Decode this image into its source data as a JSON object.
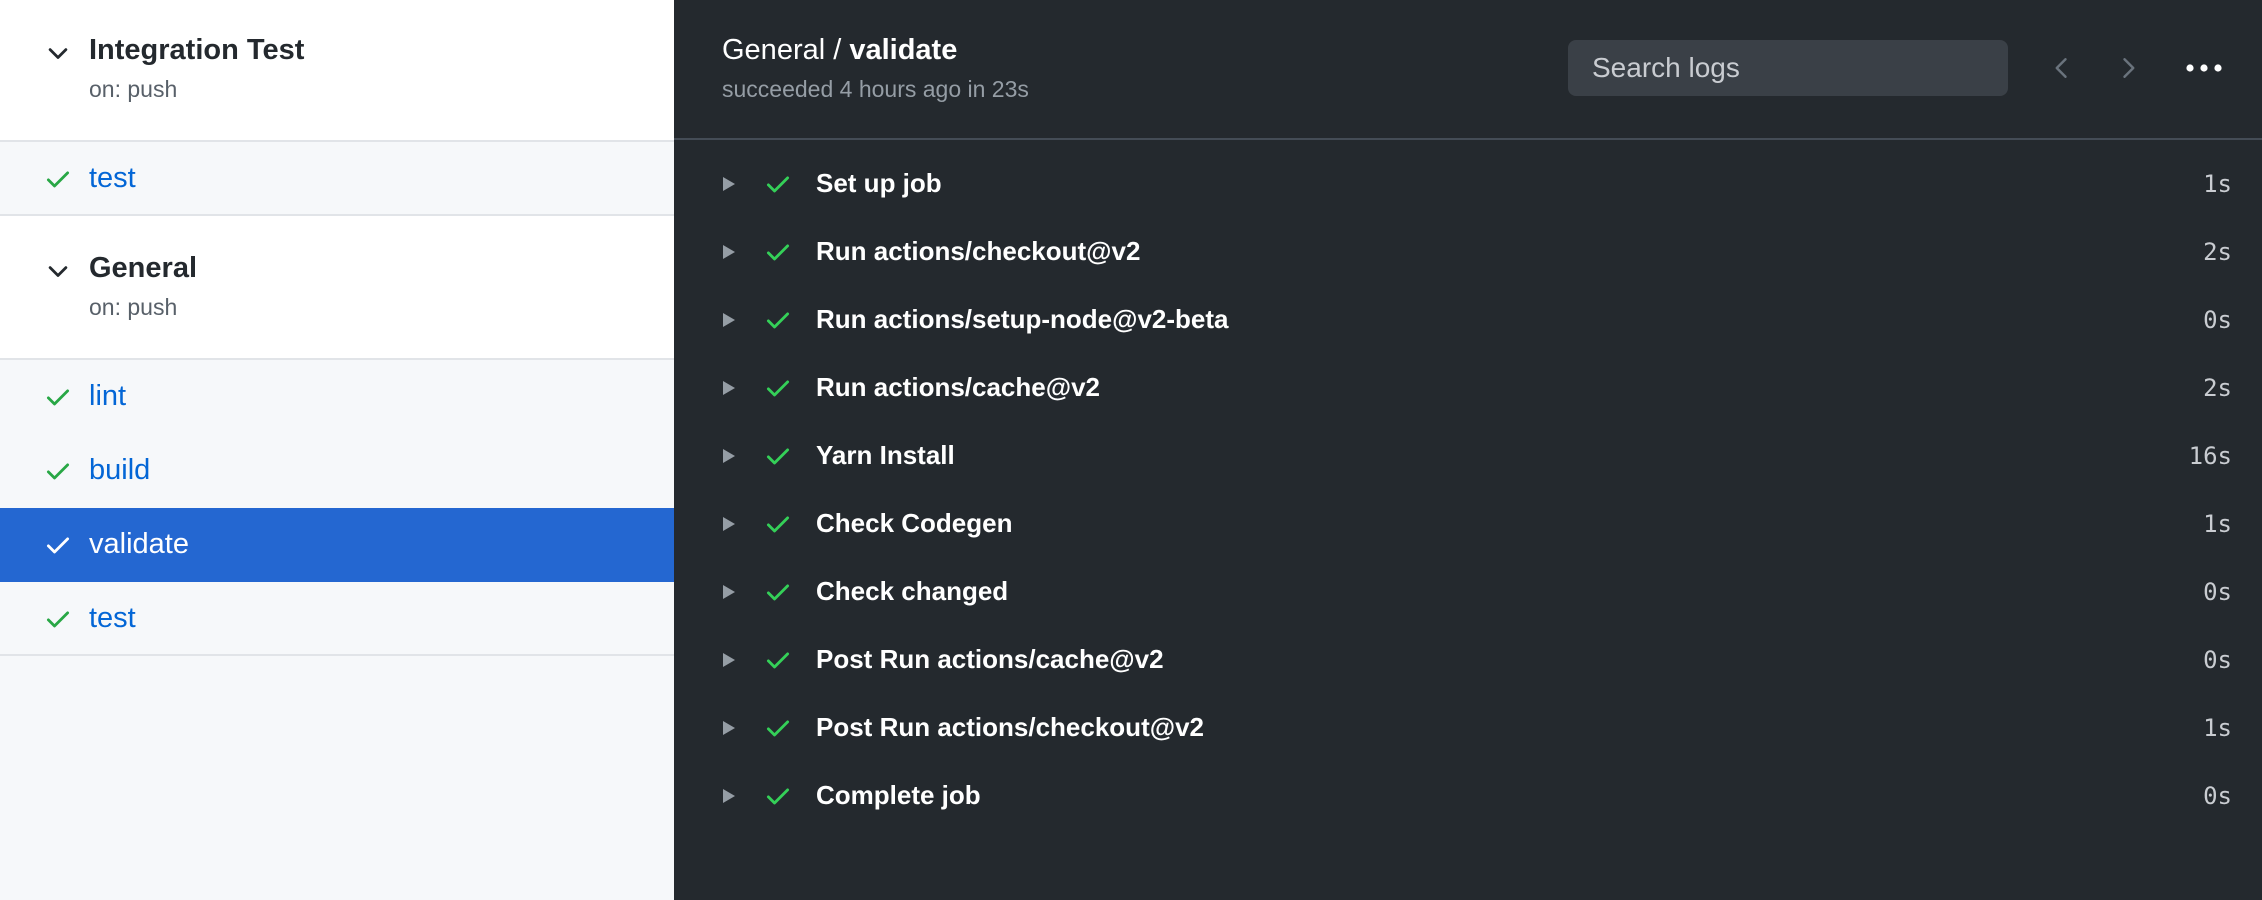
{
  "sidebar": {
    "workflows": [
      {
        "name": "Integration Test",
        "trigger": "on: push",
        "jobs": [
          {
            "label": "test",
            "status": "success"
          }
        ]
      },
      {
        "name": "General",
        "trigger": "on: push",
        "jobs": [
          {
            "label": "lint",
            "status": "success"
          },
          {
            "label": "build",
            "status": "success"
          },
          {
            "label": "validate",
            "status": "success",
            "selected": true
          },
          {
            "label": "test",
            "status": "success"
          }
        ]
      }
    ]
  },
  "header": {
    "workflow": "General",
    "separator": " / ",
    "job": "validate",
    "status_text": "succeeded 4 hours ago in 23s",
    "search_placeholder": "Search logs"
  },
  "steps": [
    {
      "name": "Set up job",
      "duration": "1s"
    },
    {
      "name": "Run actions/checkout@v2",
      "duration": "2s"
    },
    {
      "name": "Run actions/setup-node@v2-beta",
      "duration": "0s"
    },
    {
      "name": "Run actions/cache@v2",
      "duration": "2s"
    },
    {
      "name": "Yarn Install",
      "duration": "16s"
    },
    {
      "name": "Check Codegen",
      "duration": "1s"
    },
    {
      "name": "Check changed",
      "duration": "0s"
    },
    {
      "name": "Post Run actions/cache@v2",
      "duration": "0s"
    },
    {
      "name": "Post Run actions/checkout@v2",
      "duration": "1s"
    },
    {
      "name": "Complete job",
      "duration": "0s"
    }
  ],
  "icons": {
    "collapse": "chevron-down-icon",
    "success": "check-icon",
    "expand_step": "triangle-right-icon",
    "prev": "chevron-left-icon",
    "next": "chevron-right-icon",
    "more": "kebab-horizontal-icon"
  },
  "colors": {
    "success": "#34d058",
    "success_light": "#28a745",
    "link": "#0366d6",
    "selected_bg": "#2467d1",
    "dark_bg": "#24292e"
  }
}
